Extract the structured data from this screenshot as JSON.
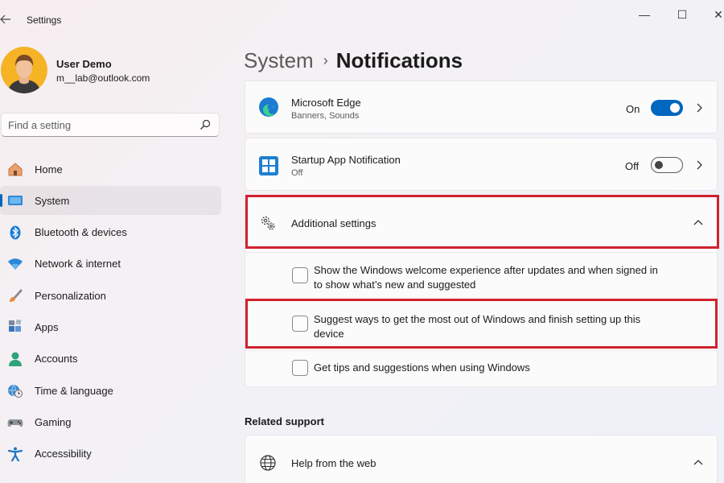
{
  "window": {
    "title": "Settings",
    "back_icon": "back-arrow-icon",
    "controls": {
      "minimize": "—",
      "maximize": "☐",
      "close": "✕"
    }
  },
  "profile": {
    "name": "User Demo",
    "email": "m__lab@outlook.com"
  },
  "search": {
    "placeholder": "Find a setting"
  },
  "sidebar": {
    "items": [
      {
        "label": "Home",
        "icon": "home-icon",
        "selected": false
      },
      {
        "label": "System",
        "icon": "system-icon",
        "selected": true
      },
      {
        "label": "Bluetooth & devices",
        "icon": "bluetooth-icon",
        "selected": false
      },
      {
        "label": "Network & internet",
        "icon": "wifi-icon",
        "selected": false
      },
      {
        "label": "Personalization",
        "icon": "brush-icon",
        "selected": false
      },
      {
        "label": "Apps",
        "icon": "apps-icon",
        "selected": false
      },
      {
        "label": "Accounts",
        "icon": "accounts-icon",
        "selected": false
      },
      {
        "label": "Time & language",
        "icon": "globe-clock-icon",
        "selected": false
      },
      {
        "label": "Gaming",
        "icon": "gamepad-icon",
        "selected": false
      },
      {
        "label": "Accessibility",
        "icon": "accessibility-icon",
        "selected": false
      }
    ]
  },
  "breadcrumb": {
    "parent": "System",
    "separator": "›",
    "current": "Notifications"
  },
  "apps": [
    {
      "name": "Microsoft Edge",
      "detail": "Banners, Sounds",
      "state": "On",
      "enabled": true,
      "icon": "edge-icon"
    },
    {
      "name": "Startup App Notification",
      "detail": "Off",
      "state": "Off",
      "enabled": false,
      "icon": "startup-app-icon"
    }
  ],
  "additional_settings": {
    "title": "Additional settings",
    "expanded": true,
    "options": [
      {
        "label_line1": "Show the Windows welcome experience after updates and when signed in",
        "label_line2": "to show what’s new and suggested",
        "checked": false
      },
      {
        "label_line1": "Suggest ways to get the most out of Windows and finish setting up this",
        "label_line2": "device",
        "checked": false
      },
      {
        "label_line1": "Get tips and suggestions when using Windows",
        "label_line2": "",
        "checked": false
      }
    ]
  },
  "related_support": {
    "heading": "Related support",
    "items": [
      {
        "label": "Help from the web",
        "expanded": true,
        "icon": "globe-icon"
      }
    ]
  },
  "colors": {
    "accent": "#0067c0",
    "highlight_border": "#d1212e"
  }
}
